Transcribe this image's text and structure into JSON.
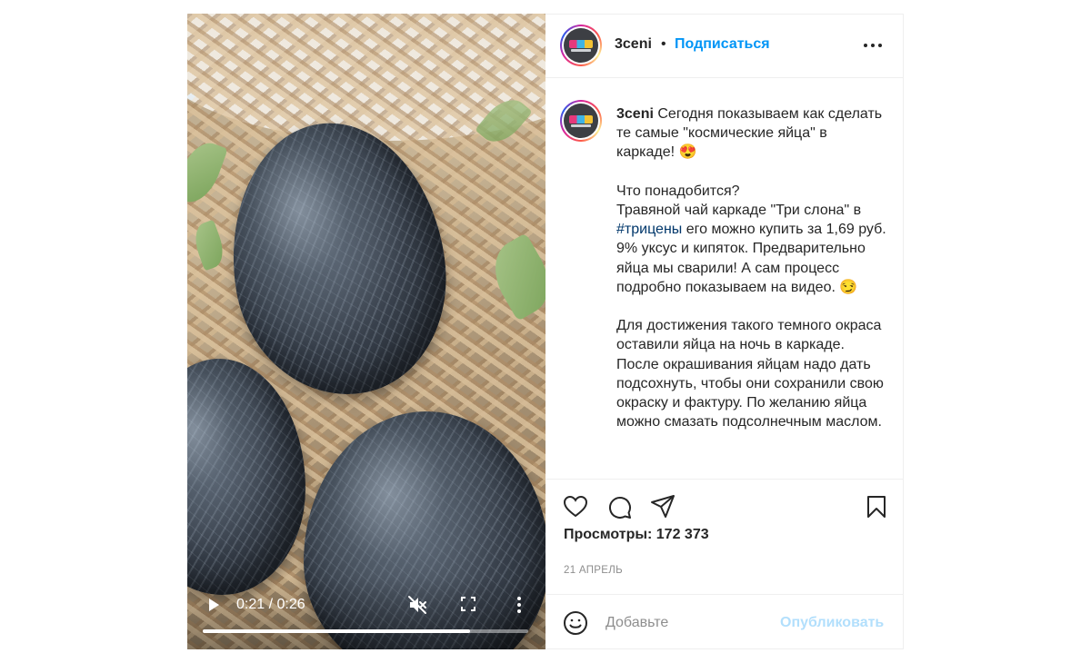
{
  "video": {
    "time_display": "0:21 / 0:26",
    "progress_fraction": 0.82,
    "muted": true
  },
  "header": {
    "username": "3ceni",
    "separator": "•",
    "follow_label": "Подписаться"
  },
  "caption": {
    "username": "3ceni",
    "text_part1": "Сегодня показываем как сделать те самые \"космические яйца\" в каркаде! 😍\n\nЧто понадобится?\nТравяной чай каркаде \"Три слона\" в ",
    "hashtag": "#трицены",
    "text_part2": " его можно купить за 1,69 руб. 9% уксус и кипяток. Предварительно яйца мы сварили! А сам процесс подробно показываем на видео. 😏\n\nДля достижения такого темного окраса оставили яйца на ночь в каркаде. После окрашивания яйцам надо дать подсохнуть, чтобы они сохранили свою окраску и фактуру. По желанию яйца можно смазать подсолнечным маслом."
  },
  "stats": {
    "views": "Просмотры: 172 373",
    "date": "21 АПРЕЛЬ"
  },
  "comment": {
    "placeholder": "Добавьте",
    "publish_label": "Опубликовать"
  },
  "colors": {
    "accent": "#0095f6",
    "publish_disabled": "#b2dffc",
    "secondary_text": "#8e8e8e",
    "hashtag": "#00376b"
  },
  "icons": {
    "play": "play-icon",
    "mute": "volume-muted-icon",
    "fullscreen": "fullscreen-icon",
    "more_video": "vertical-dots-icon",
    "more_header": "horizontal-dots-icon",
    "like": "heart-icon",
    "comment": "comment-bubble-icon",
    "share": "paper-plane-icon",
    "save": "bookmark-icon",
    "emoji": "smiley-icon"
  }
}
